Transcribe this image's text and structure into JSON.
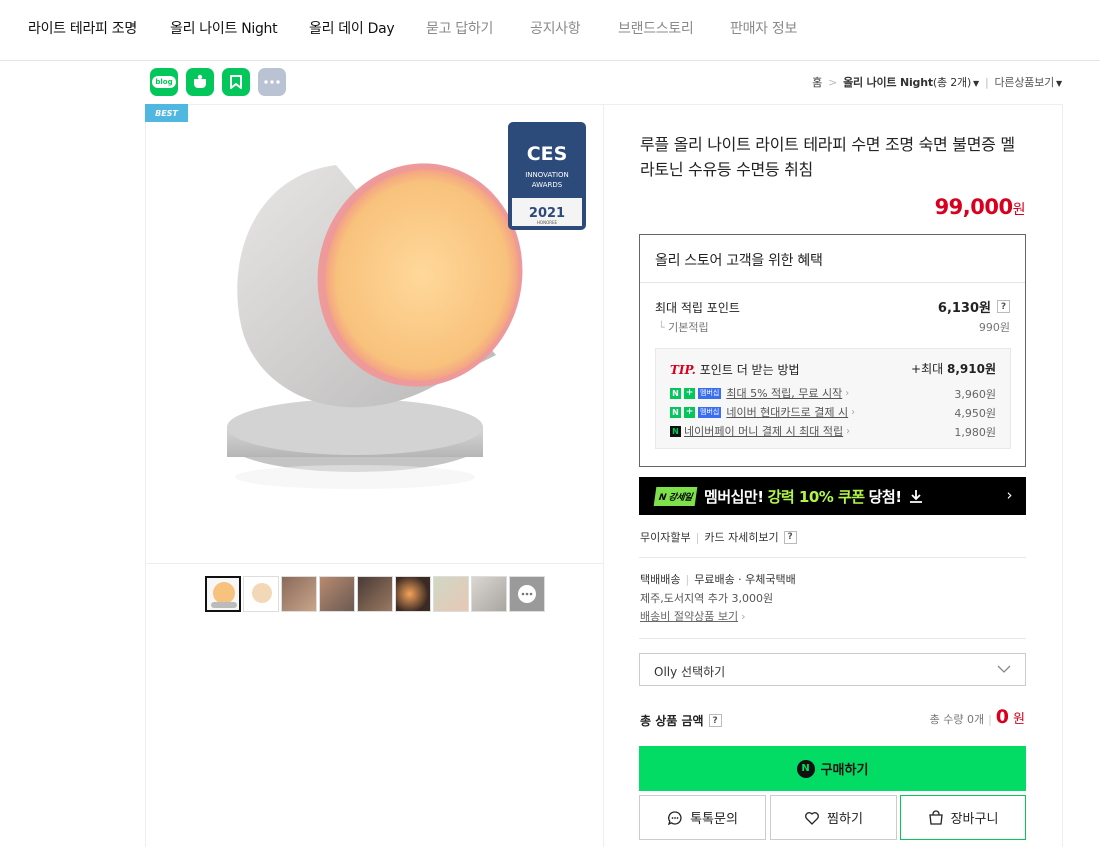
{
  "nav": {
    "items": [
      {
        "label": "라이트 테라피 조명",
        "state": "dark"
      },
      {
        "label": "올리 나이트 Night",
        "state": "dark"
      },
      {
        "label": "올리 데이 Day",
        "state": "dark"
      },
      {
        "label": "묻고 답하기",
        "state": "gray"
      },
      {
        "label": "공지사항",
        "state": "gray"
      },
      {
        "label": "브랜드스토리",
        "state": "gray"
      },
      {
        "label": "판매자 정보",
        "state": "gray"
      }
    ]
  },
  "share": {
    "icons": [
      "blog-icon",
      "talk-icon",
      "bookmark-icon",
      "more-icon"
    ],
    "blog_text": "blog"
  },
  "breadcrumb": {
    "home": "홈",
    "category": "올리 나이트 Night",
    "count": "(총 2개)",
    "other": "다른상품보기"
  },
  "gallery": {
    "badge": "BEST",
    "ces": {
      "title": "CES",
      "sub1": "INNOVATION",
      "sub2": "AWARDS",
      "year": "2021",
      "honoree": "HONOREE"
    },
    "thumb_count": 9
  },
  "product": {
    "title": "루플 올리 나이트 라이트 테라피 수면 조명 숙면 불면증 멜라토닌 수유등 수면등 취침",
    "price": "99,000",
    "currency": "원"
  },
  "benefit": {
    "header": "올리 스토어 고객을 위한 혜택",
    "max_point_label": "최대 적립 포인트",
    "max_point_value": "6,130원",
    "base_label": "기본적립",
    "base_value": "990원",
    "tip_mark": "TIP.",
    "tip_label": "포인트 더 받는 방법",
    "tip_max": "+최대",
    "tip_max_value": "8,910원",
    "rows": [
      {
        "text": "최대 5% 적립, 무료 시작",
        "value": "3,960원",
        "badge": "멤버십"
      },
      {
        "text": "네이버 현대카드로 결제 시",
        "value": "4,950원",
        "badge": "멤버십"
      },
      {
        "text": "네이버페이 머니 결제 시 최대 적립",
        "value": "1,980원",
        "badge": ""
      }
    ]
  },
  "banner": {
    "logo": "N 강세일",
    "pre": "멤버십만!",
    "highlight": "강력 10% 쿠폰",
    "post": "당첨!"
  },
  "payment": {
    "installment": "무이자할부",
    "card_detail": "카드 자세히보기"
  },
  "shipping": {
    "method": "택배배송",
    "fee": "무료배송 · 우체국택배",
    "extra": "제주,도서지역 추가 3,000원",
    "saving_link": "배송비 절약상품 보기"
  },
  "option": {
    "placeholder": "Olly 선택하기"
  },
  "total": {
    "label": "총 상품 금액",
    "qty_label": "총 수량 0개",
    "value": "0",
    "currency": "원"
  },
  "actions": {
    "buy": "구매하기",
    "talk": "톡톡문의",
    "wish": "찜하기",
    "cart": "장바구니"
  },
  "colors": {
    "naver_green": "#03c75a",
    "buy_green": "#03dc64",
    "price_red": "#d8001e"
  }
}
